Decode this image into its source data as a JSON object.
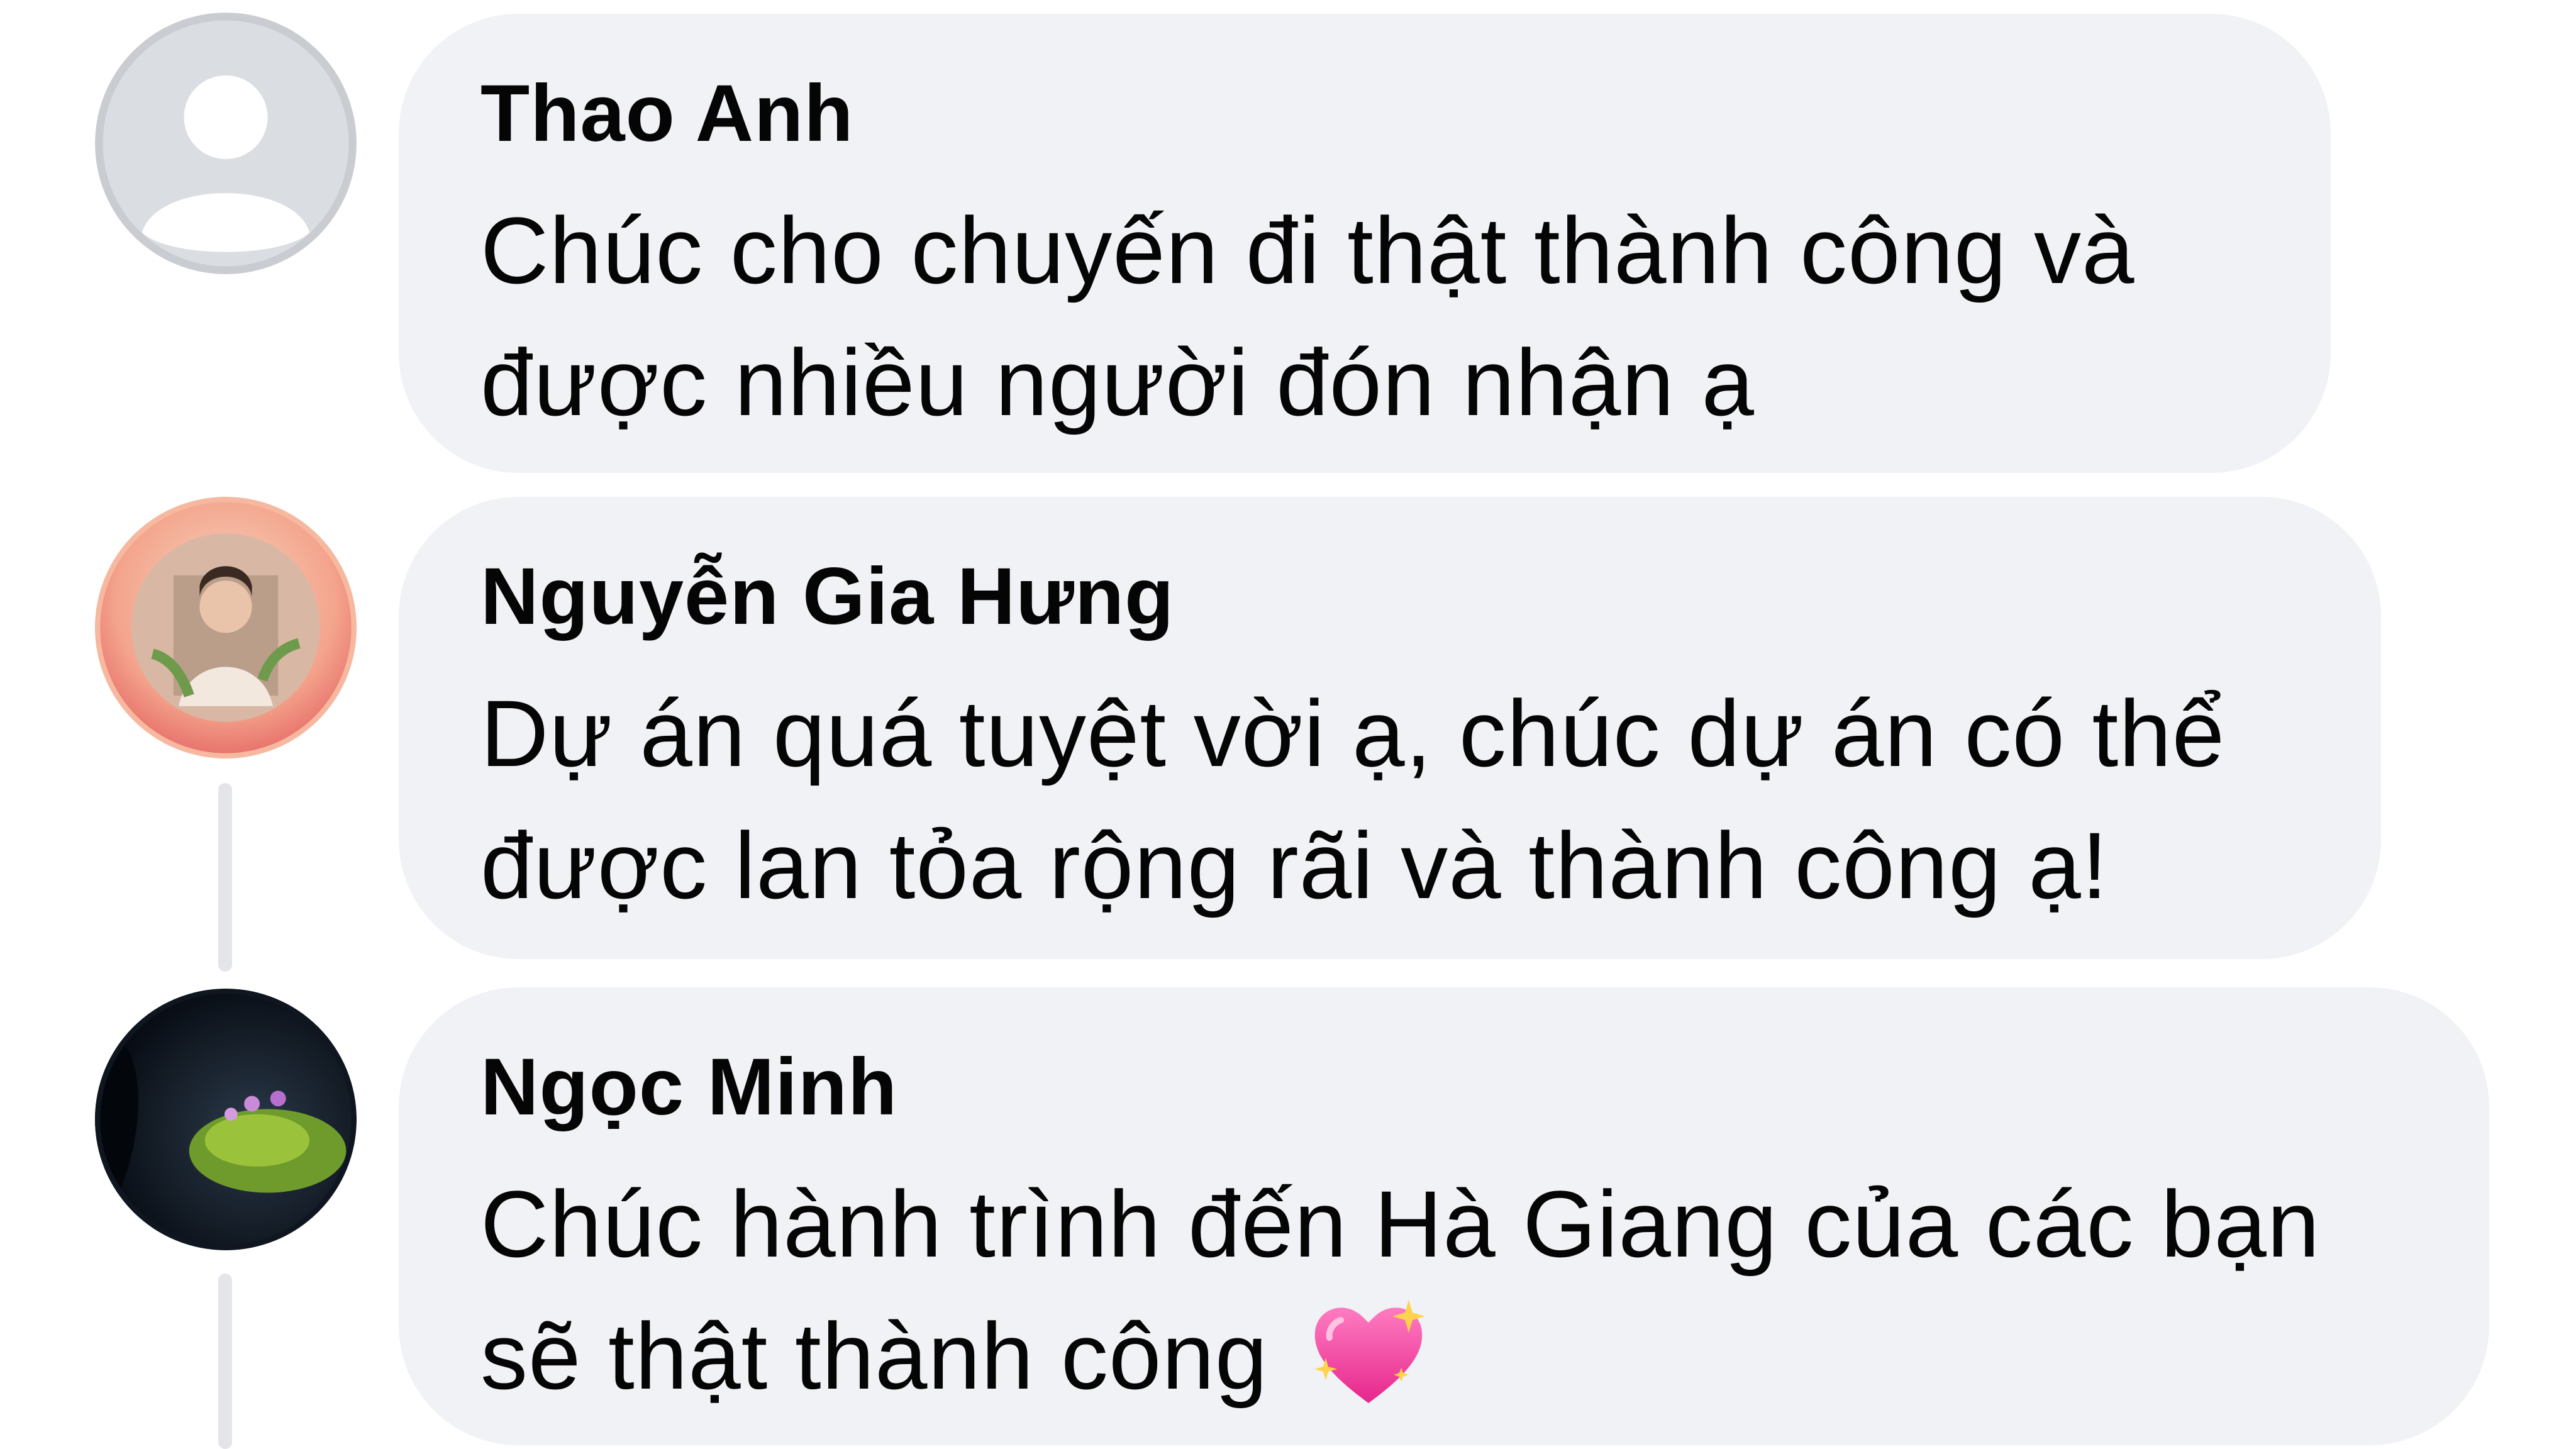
{
  "comments": [
    {
      "author": "Thao Anh",
      "avatar": "default-profile-icon",
      "text": "Chúc cho chuyến đi thật thành công và được nhiều người đón nhận ạ"
    },
    {
      "author": "Nguyễn Gia Hưng",
      "avatar": "profile-photo-avatar",
      "text": "Dự án quá tuyệt vời ạ, chúc dự án có thể được lan tỏa rộng rãi và thành công ạ!"
    },
    {
      "author": "Ngọc Minh",
      "avatar": "profile-photo-avatar",
      "text": "Chúc hành trình đến Hà Giang của các bạn sẽ thật thành công",
      "emoji": "sparkling-heart-icon"
    }
  ],
  "colors": {
    "bubble_background": "#f0f2f5",
    "thread_line": "#e3e5e9",
    "text": "#050505",
    "heart": "#ff4fa3"
  }
}
